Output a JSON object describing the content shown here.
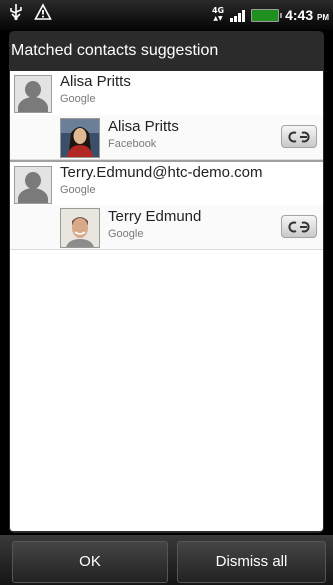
{
  "status_bar": {
    "icons": [
      "usb-icon",
      "warning-icon"
    ],
    "network": "4G",
    "time": "4:43",
    "ampm": "PM"
  },
  "dialog": {
    "title": "Matched contacts suggestion",
    "groups": [
      {
        "parent": {
          "name": "Alisa Pritts",
          "source": "Google"
        },
        "match": {
          "name": "Alisa Pritts",
          "source": "Facebook"
        }
      },
      {
        "parent": {
          "name": "Terry.Edmund@htc-demo.com",
          "source": "Google"
        },
        "match": {
          "name": "Terry Edmund",
          "source": "Google"
        }
      }
    ]
  },
  "buttons": {
    "ok": "OK",
    "dismiss": "Dismiss all"
  }
}
